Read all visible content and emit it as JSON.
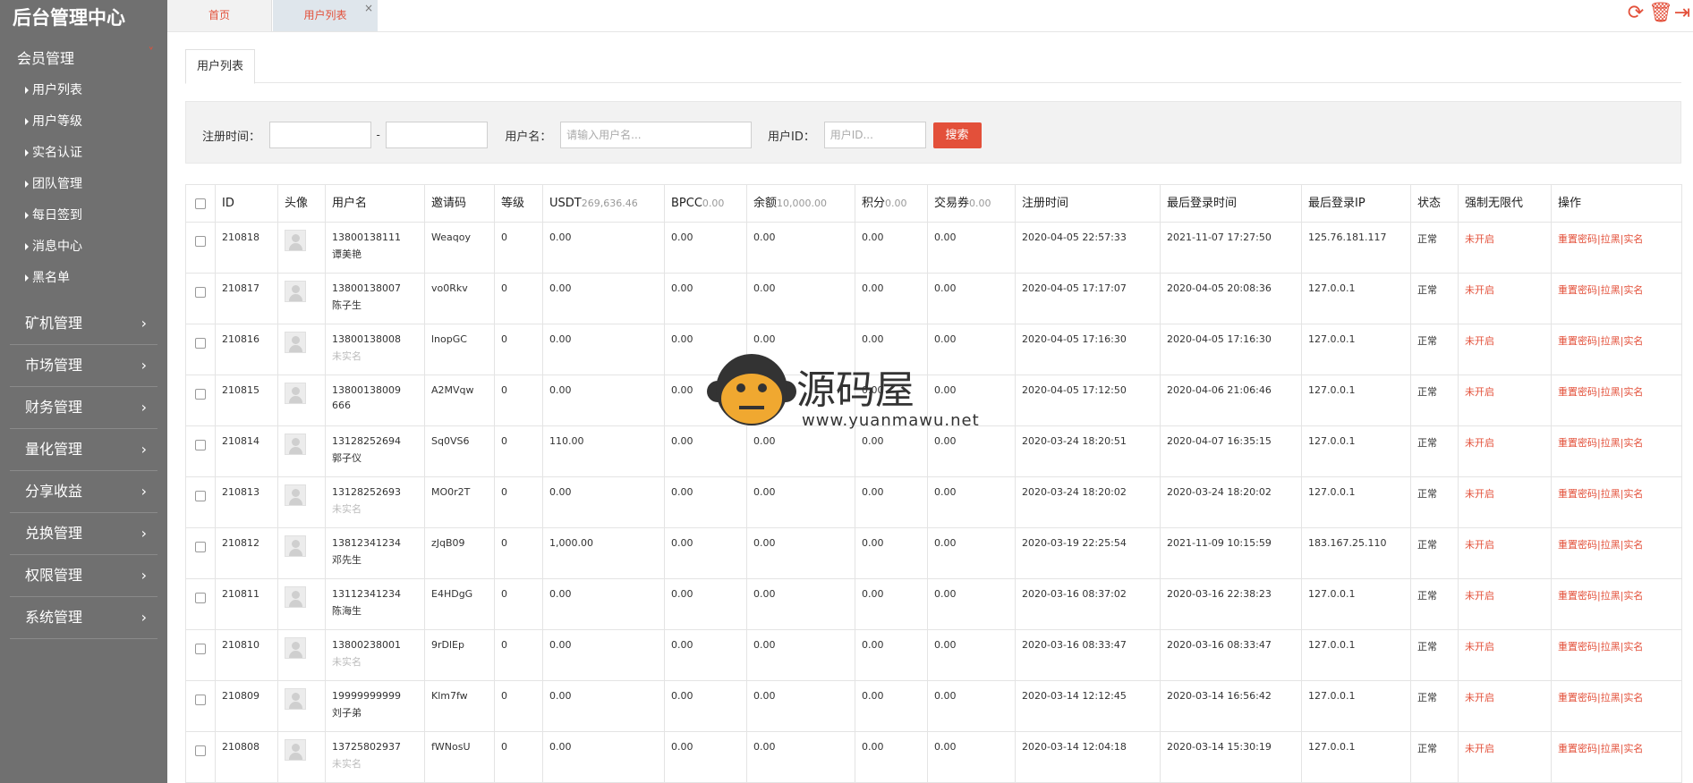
{
  "brand": "后台管理中心",
  "sidebar": {
    "groups": [
      {
        "label": "会员管理",
        "items": [
          "用户列表",
          "用户等级",
          "实名认证",
          "团队管理",
          "每日签到",
          "消息中心",
          "黑名单"
        ]
      },
      {
        "label": "矿机管理"
      },
      {
        "label": "市场管理"
      },
      {
        "label": "财务管理"
      },
      {
        "label": "量化管理"
      },
      {
        "label": "分享收益"
      },
      {
        "label": "兑换管理"
      },
      {
        "label": "权限管理"
      },
      {
        "label": "系统管理"
      }
    ],
    "chevron": "›",
    "chevron_active": "˅"
  },
  "topbar": {
    "tabs": [
      "首页",
      "用户列表"
    ],
    "close": "×",
    "actions": [
      {
        "icon": "refresh-icon",
        "glyph": "⟳"
      },
      {
        "icon": "trash-icon",
        "glyph": "🗑"
      },
      {
        "icon": "logout-icon",
        "glyph": "⇥"
      }
    ]
  },
  "inner_tab": "用户列表",
  "filter": {
    "reg_time_label": "注册时间：",
    "dash": "-",
    "username_label": "用户名：",
    "username_placeholder": "请输入用户名...",
    "userid_label": "用户ID：",
    "userid_placeholder": "用户ID...",
    "search": "搜索"
  },
  "table": {
    "headers": {
      "id": "ID",
      "avatar": "头像",
      "username": "用户名",
      "invite": "邀请码",
      "level": "等级",
      "usdt": "USDT",
      "usdt_sum": "269,636.46",
      "bpcc": "BPCC",
      "bpcc_sum": "0.00",
      "balance": "余额",
      "balance_sum": "10,000.00",
      "points": "积分",
      "points_sum": "0.00",
      "voucher": "交易券",
      "voucher_sum": "0.00",
      "reg_time": "注册时间",
      "last_login": "最后登录时间",
      "last_ip": "最后登录IP",
      "status": "状态",
      "force": "强制无限代",
      "ops": "操作"
    },
    "ops_labels": {
      "reset": "重置密码",
      "block": "拉黑",
      "realname": "实名",
      "sep": "|"
    },
    "rows": [
      {
        "id": "210818",
        "phone": "13800138111",
        "name": "谭美艳",
        "named": true,
        "invite": "Weaqoy",
        "level": "0",
        "usdt": "0.00",
        "bpcc": "0.00",
        "balance": "0.00",
        "points": "0.00",
        "voucher": "0.00",
        "reg": "2020-04-05 22:57:33",
        "login": "2021-11-07 17:27:50",
        "ip": "125.76.181.117",
        "status": "正常",
        "force": "未开启"
      },
      {
        "id": "210817",
        "phone": "13800138007",
        "name": "陈子生",
        "named": true,
        "invite": "vo0Rkv",
        "level": "0",
        "usdt": "0.00",
        "bpcc": "0.00",
        "balance": "0.00",
        "points": "0.00",
        "voucher": "0.00",
        "reg": "2020-04-05 17:17:07",
        "login": "2020-04-05 20:08:36",
        "ip": "127.0.0.1",
        "status": "正常",
        "force": "未开启"
      },
      {
        "id": "210816",
        "phone": "13800138008",
        "name": "未实名",
        "named": false,
        "invite": "lnopGC",
        "level": "0",
        "usdt": "0.00",
        "bpcc": "0.00",
        "balance": "0.00",
        "points": "0.00",
        "voucher": "0.00",
        "reg": "2020-04-05 17:16:30",
        "login": "2020-04-05 17:16:30",
        "ip": "127.0.0.1",
        "status": "正常",
        "force": "未开启"
      },
      {
        "id": "210815",
        "phone": "13800138009",
        "name": "666",
        "named": true,
        "invite": "A2MVqw",
        "level": "0",
        "usdt": "0.00",
        "bpcc": "0.00",
        "balance": "0.00",
        "points": "0.00",
        "voucher": "0.00",
        "reg": "2020-04-05 17:12:50",
        "login": "2020-04-06 21:06:46",
        "ip": "127.0.0.1",
        "status": "正常",
        "force": "未开启"
      },
      {
        "id": "210814",
        "phone": "13128252694",
        "name": "郭子仪",
        "named": true,
        "invite": "Sq0VS6",
        "level": "0",
        "usdt": "110.00",
        "bpcc": "0.00",
        "balance": "0.00",
        "points": "0.00",
        "voucher": "0.00",
        "reg": "2020-03-24 18:20:51",
        "login": "2020-04-07 16:35:15",
        "ip": "127.0.0.1",
        "status": "正常",
        "force": "未开启"
      },
      {
        "id": "210813",
        "phone": "13128252693",
        "name": "未实名",
        "named": false,
        "invite": "MO0r2T",
        "level": "0",
        "usdt": "0.00",
        "bpcc": "0.00",
        "balance": "0.00",
        "points": "0.00",
        "voucher": "0.00",
        "reg": "2020-03-24 18:20:02",
        "login": "2020-03-24 18:20:02",
        "ip": "127.0.0.1",
        "status": "正常",
        "force": "未开启"
      },
      {
        "id": "210812",
        "phone": "13812341234",
        "name": "邓先生",
        "named": true,
        "invite": "zJqB09",
        "level": "0",
        "usdt": "1,000.00",
        "bpcc": "0.00",
        "balance": "0.00",
        "points": "0.00",
        "voucher": "0.00",
        "reg": "2020-03-19 22:25:54",
        "login": "2021-11-09 10:15:59",
        "ip": "183.167.25.110",
        "status": "正常",
        "force": "未开启"
      },
      {
        "id": "210811",
        "phone": "13112341234",
        "name": "陈海生",
        "named": true,
        "invite": "E4HDgG",
        "level": "0",
        "usdt": "0.00",
        "bpcc": "0.00",
        "balance": "0.00",
        "points": "0.00",
        "voucher": "0.00",
        "reg": "2020-03-16 08:37:02",
        "login": "2020-03-16 22:38:23",
        "ip": "127.0.0.1",
        "status": "正常",
        "force": "未开启"
      },
      {
        "id": "210810",
        "phone": "13800238001",
        "name": "未实名",
        "named": false,
        "invite": "9rDlEp",
        "level": "0",
        "usdt": "0.00",
        "bpcc": "0.00",
        "balance": "0.00",
        "points": "0.00",
        "voucher": "0.00",
        "reg": "2020-03-16 08:33:47",
        "login": "2020-03-16 08:33:47",
        "ip": "127.0.0.1",
        "status": "正常",
        "force": "未开启"
      },
      {
        "id": "210809",
        "phone": "19999999999",
        "name": "刘子弟",
        "named": true,
        "invite": "Klm7fw",
        "level": "0",
        "usdt": "0.00",
        "bpcc": "0.00",
        "balance": "0.00",
        "points": "0.00",
        "voucher": "0.00",
        "reg": "2020-03-14 12:12:45",
        "login": "2020-03-14 16:56:42",
        "ip": "127.0.0.1",
        "status": "正常",
        "force": "未开启"
      },
      {
        "id": "210808",
        "phone": "13725802937",
        "name": "未实名",
        "named": false,
        "invite": "fWNosU",
        "level": "0",
        "usdt": "0.00",
        "bpcc": "0.00",
        "balance": "0.00",
        "points": "0.00",
        "voucher": "0.00",
        "reg": "2020-03-14 12:04:18",
        "login": "2020-03-14 15:30:19",
        "ip": "127.0.0.1",
        "status": "正常",
        "force": "未开启"
      }
    ]
  },
  "watermark": {
    "text": "源码屋",
    "url": "www.yuanmawu.net"
  },
  "colors": {
    "accent": "#e3503a",
    "sidebar": "#707070"
  }
}
